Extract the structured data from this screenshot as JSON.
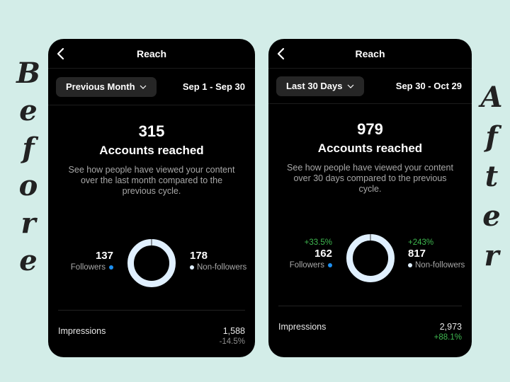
{
  "labels": {
    "before": "Before",
    "after": "After"
  },
  "colors": {
    "background": "#d3ede8",
    "followers_dot": "#1d8ff0",
    "nonfollowers_dot": "#e0f0ff",
    "positive": "#3fb950",
    "negative": "#8e8e8e"
  },
  "before": {
    "nav_title": "Reach",
    "dropdown_label": "Previous Month",
    "date_range": "Sep 1 - Sep 30",
    "accounts_reached": "315",
    "accounts_reached_label": "Accounts reached",
    "description": "See how people have viewed your content over the last month compared to the previous cycle.",
    "followers": {
      "value": "137",
      "label": "Followers",
      "change": ""
    },
    "non_followers": {
      "value": "178",
      "label": "Non-followers",
      "change": ""
    },
    "impressions": {
      "label": "Impressions",
      "value": "1,588",
      "change": "-14.5%"
    }
  },
  "after": {
    "nav_title": "Reach",
    "dropdown_label": "Last 30 Days",
    "date_range": "Sep 30 - Oct 29",
    "accounts_reached": "979",
    "accounts_reached_label": "Accounts reached",
    "description": "See how people have viewed your content over 30 days compared to the previous cycle.",
    "followers": {
      "value": "162",
      "label": "Followers",
      "change": "+33.5%"
    },
    "non_followers": {
      "value": "817",
      "label": "Non-followers",
      "change": "+243%"
    },
    "impressions": {
      "label": "Impressions",
      "value": "2,973",
      "change": "+88.1%"
    }
  }
}
